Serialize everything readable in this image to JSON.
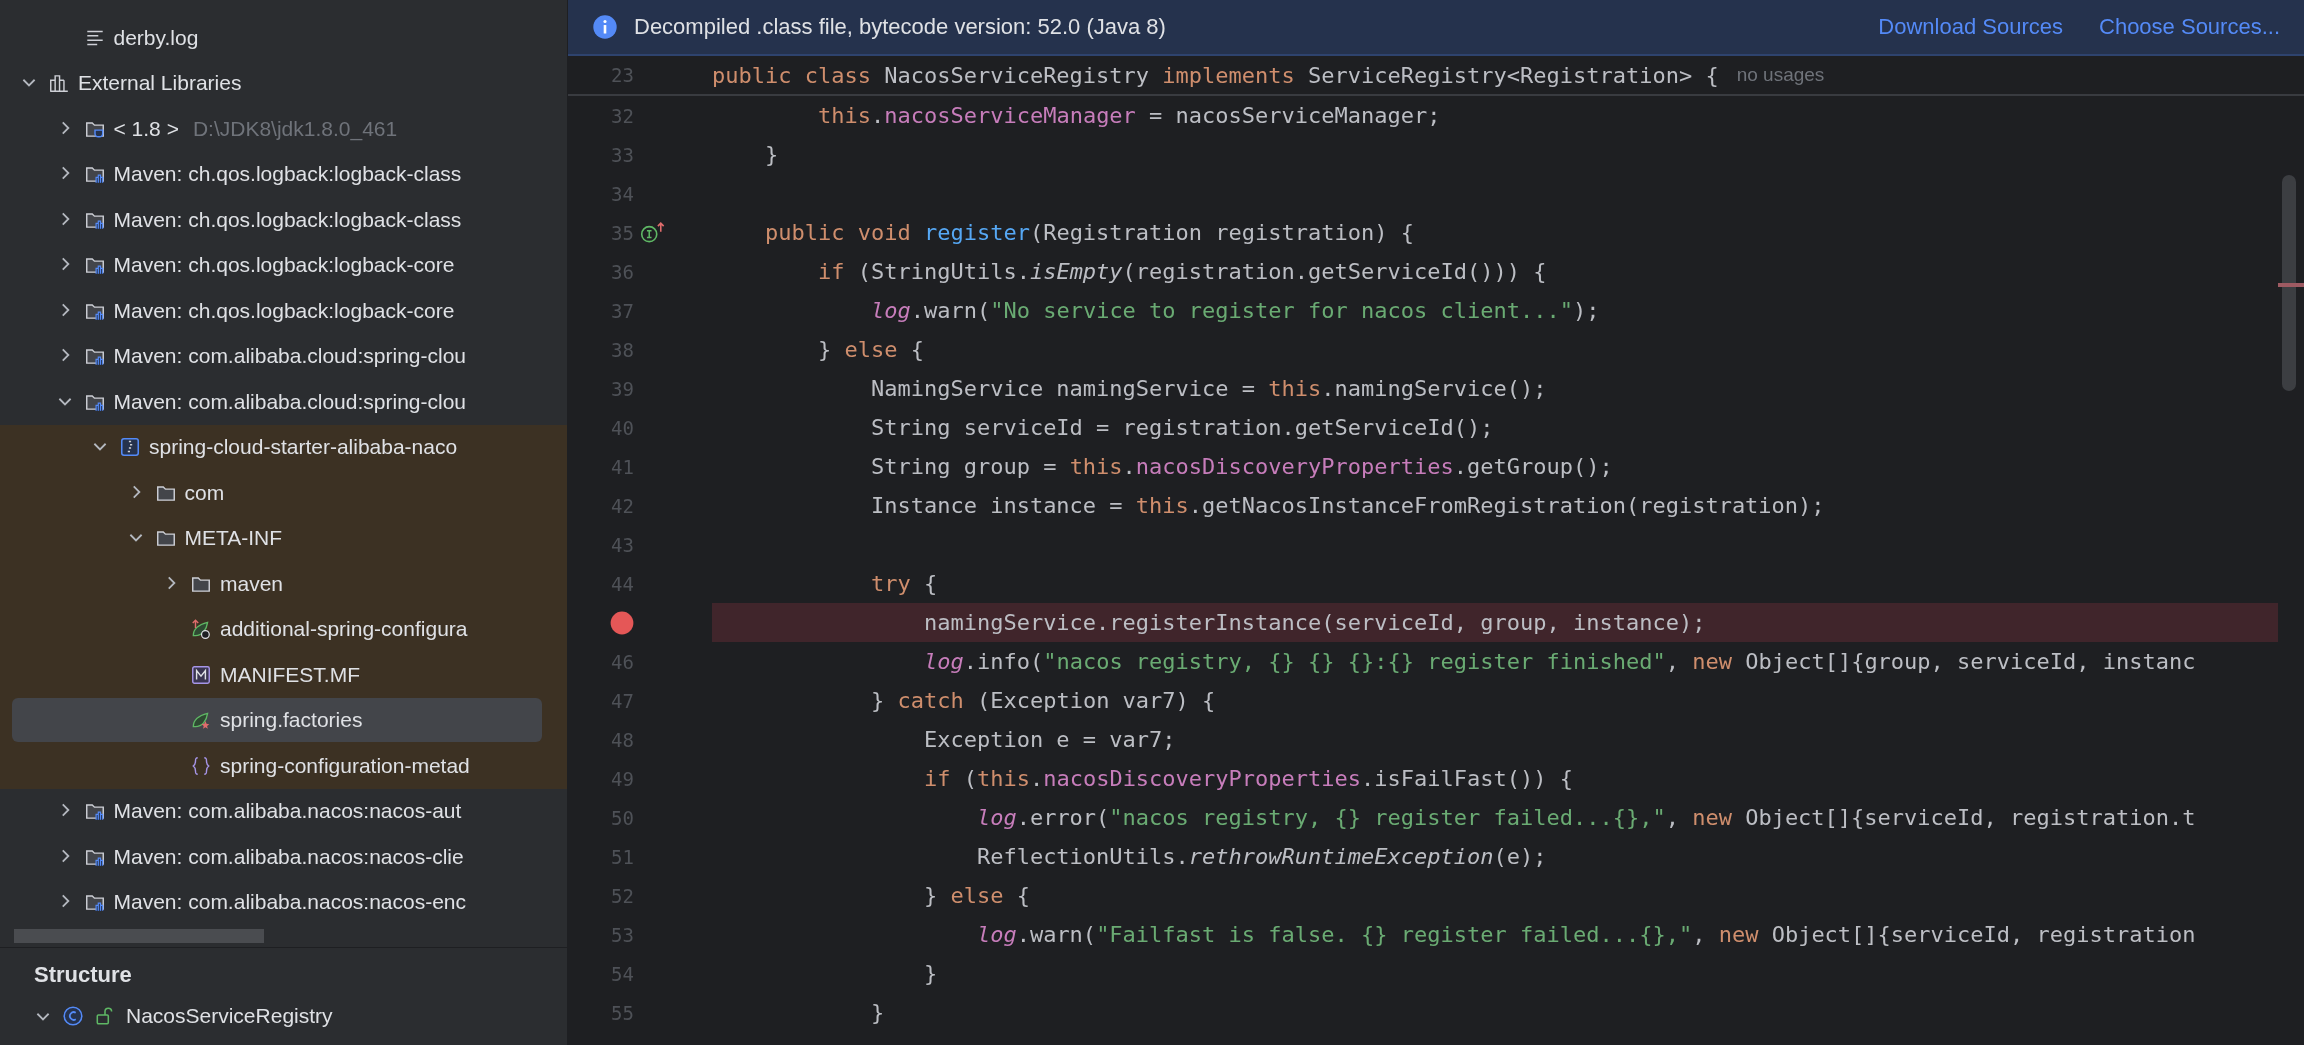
{
  "project_tree": {
    "items": [
      {
        "children": [
          {
            "label": "derby.log",
            "kind": "log-file",
            "selected": false
          }
        ]
      },
      {
        "label": "External Libraries",
        "kind": "libraries",
        "expanded": true,
        "selected": false,
        "children": [
          {
            "label": "< 1.8 >",
            "path": "D:\\JDK8\\jdk1.8.0_461",
            "kind": "jdk",
            "expanded": false,
            "selected": false
          },
          {
            "label": "Maven: ch.qos.logback:logback-class",
            "kind": "maven-library",
            "expanded": false,
            "selected": false
          },
          {
            "label": "Maven: ch.qos.logback:logback-class",
            "kind": "maven-library",
            "expanded": false,
            "selected": false
          },
          {
            "label": "Maven: ch.qos.logback:logback-core",
            "kind": "maven-library",
            "expanded": false,
            "selected": false
          },
          {
            "label": "Maven: ch.qos.logback:logback-core",
            "kind": "maven-library",
            "expanded": false,
            "selected": false
          },
          {
            "label": "Maven: com.alibaba.cloud:spring-clou",
            "kind": "maven-library",
            "expanded": false,
            "selected": false
          },
          {
            "label": "Maven: com.alibaba.cloud:spring-clou",
            "kind": "maven-library",
            "expanded": true,
            "selected": false,
            "children": [
              {
                "label": "spring-cloud-starter-alibaba-naco",
                "kind": "jar",
                "expanded": true,
                "selected": false,
                "highlighted": true,
                "children": [
                  {
                    "label": "com",
                    "kind": "folder",
                    "expanded": false,
                    "selected": false
                  },
                  {
                    "label": "META-INF",
                    "kind": "folder",
                    "expanded": true,
                    "selected": false,
                    "children": [
                      {
                        "label": "maven",
                        "kind": "folder",
                        "expanded": false,
                        "selected": false
                      },
                      {
                        "label": "additional-spring-configura",
                        "kind": "spring-config",
                        "selected": false
                      },
                      {
                        "label": "MANIFEST.MF",
                        "kind": "manifest",
                        "selected": false
                      },
                      {
                        "label": "spring.factories",
                        "kind": "spring-factories",
                        "selected": true
                      },
                      {
                        "label": "spring-configuration-metad",
                        "kind": "json-config",
                        "selected": false
                      }
                    ]
                  }
                ]
              }
            ]
          },
          {
            "label": "Maven: com.alibaba.nacos:nacos-aut",
            "kind": "maven-library",
            "expanded": false,
            "selected": false
          },
          {
            "label": "Maven: com.alibaba.nacos:nacos-clie",
            "kind": "maven-library",
            "expanded": false,
            "selected": false
          },
          {
            "label": "Maven: com.alibaba.nacos:nacos-enc",
            "kind": "maven-library",
            "expanded": false,
            "selected": false
          }
        ]
      }
    ]
  },
  "structure": {
    "title": "Structure",
    "items": [
      {
        "label": "NacosServiceRegistry",
        "kind": "class",
        "expanded": true
      }
    ]
  },
  "editor": {
    "banner": {
      "text": "Decompiled .class file, bytecode version: 52.0 (Java 8)",
      "links": [
        "Download Sources",
        "Choose Sources..."
      ]
    },
    "sticky_line": {
      "number": "23",
      "hint": "no usages",
      "tokens": [
        {
          "text": "public class ",
          "kind": "keyword"
        },
        {
          "text": "NacosServiceRegistry ",
          "kind": "plain"
        },
        {
          "text": "implements ",
          "kind": "keyword"
        },
        {
          "text": "ServiceRegistry<Registration> {",
          "kind": "plain"
        }
      ]
    },
    "lines": [
      {
        "number": "32",
        "kind": "plain",
        "breakpoint": false,
        "tokens": [
          {
            "text": "        this",
            "kind": "keyword"
          },
          {
            "text": ".",
            "kind": "plain"
          },
          {
            "text": "nacosServiceManager",
            "kind": "field"
          },
          {
            "text": " = nacosServiceManager;",
            "kind": "plain"
          }
        ]
      },
      {
        "number": "33",
        "kind": "plain",
        "breakpoint": false,
        "tokens": [
          {
            "text": "    }",
            "kind": "plain"
          }
        ]
      },
      {
        "number": "34",
        "kind": "plain",
        "breakpoint": false
      },
      {
        "number": "35",
        "kind": "implements",
        "breakpoint": false,
        "tokens": [
          {
            "text": "    public void ",
            "kind": "keyword"
          },
          {
            "text": "register",
            "kind": "method-decl"
          },
          {
            "text": "(Registration registration) {",
            "kind": "plain"
          }
        ]
      },
      {
        "number": "36",
        "kind": "plain",
        "breakpoint": false,
        "tokens": [
          {
            "text": "        if ",
            "kind": "keyword"
          },
          {
            "text": "(StringUtils.",
            "kind": "plain"
          },
          {
            "text": "isEmpty",
            "kind": "static-method"
          },
          {
            "text": "(registration.getServiceId())) {",
            "kind": "plain"
          }
        ]
      },
      {
        "number": "37",
        "kind": "plain",
        "breakpoint": false,
        "tokens": [
          {
            "text": "            log",
            "kind": "static-field"
          },
          {
            "text": ".warn(",
            "kind": "plain"
          },
          {
            "text": "\"No service to register for nacos client...\"",
            "kind": "string"
          },
          {
            "text": ");",
            "kind": "plain"
          }
        ]
      },
      {
        "number": "38",
        "kind": "plain",
        "breakpoint": false,
        "tokens": [
          {
            "text": "        } ",
            "kind": "plain"
          },
          {
            "text": "else ",
            "kind": "keyword"
          },
          {
            "text": "{",
            "kind": "plain"
          }
        ]
      },
      {
        "number": "39",
        "kind": "plain",
        "breakpoint": false,
        "tokens": [
          {
            "text": "            NamingService namingService = ",
            "kind": "plain"
          },
          {
            "text": "this",
            "kind": "keyword"
          },
          {
            "text": ".namingService();",
            "kind": "plain"
          }
        ]
      },
      {
        "number": "40",
        "kind": "plain",
        "breakpoint": false,
        "tokens": [
          {
            "text": "            String serviceId = registration.getServiceId();",
            "kind": "plain"
          }
        ]
      },
      {
        "number": "41",
        "kind": "plain",
        "breakpoint": false,
        "tokens": [
          {
            "text": "            String group = ",
            "kind": "plain"
          },
          {
            "text": "this",
            "kind": "keyword"
          },
          {
            "text": ".",
            "kind": "plain"
          },
          {
            "text": "nacosDiscoveryProperties",
            "kind": "field"
          },
          {
            "text": ".getGroup();",
            "kind": "plain"
          }
        ]
      },
      {
        "number": "42",
        "kind": "plain",
        "breakpoint": false,
        "tokens": [
          {
            "text": "            Instance instance = ",
            "kind": "plain"
          },
          {
            "text": "this",
            "kind": "keyword"
          },
          {
            "text": ".getNacosInstanceFromRegistration(registration);",
            "kind": "plain"
          }
        ]
      },
      {
        "number": "43",
        "kind": "plain",
        "breakpoint": false
      },
      {
        "number": "44",
        "kind": "plain",
        "breakpoint": false,
        "tokens": [
          {
            "text": "            try ",
            "kind": "keyword"
          },
          {
            "text": "{",
            "kind": "plain"
          }
        ]
      },
      {
        "kind": "plain",
        "breakpoint": true,
        "tokens": [
          {
            "text": "                namingService.registerInstance(serviceId, group, instance);",
            "kind": "plain"
          }
        ]
      },
      {
        "number": "46",
        "kind": "plain",
        "breakpoint": false,
        "tokens": [
          {
            "text": "                log",
            "kind": "static-field"
          },
          {
            "text": ".info(",
            "kind": "plain"
          },
          {
            "text": "\"nacos registry, {} {} {}:{} register finished\"",
            "kind": "string"
          },
          {
            "text": ", ",
            "kind": "plain"
          },
          {
            "text": "new ",
            "kind": "keyword"
          },
          {
            "text": "Object[]{group, serviceId, instanc",
            "kind": "plain"
          }
        ]
      },
      {
        "number": "47",
        "kind": "plain",
        "breakpoint": false,
        "tokens": [
          {
            "text": "            } ",
            "kind": "plain"
          },
          {
            "text": "catch ",
            "kind": "keyword"
          },
          {
            "text": "(Exception var7) {",
            "kind": "plain"
          }
        ]
      },
      {
        "number": "48",
        "kind": "plain",
        "breakpoint": false,
        "tokens": [
          {
            "text": "                Exception e = var7;",
            "kind": "plain"
          }
        ]
      },
      {
        "number": "49",
        "kind": "plain",
        "breakpoint": false,
        "tokens": [
          {
            "text": "                if ",
            "kind": "keyword"
          },
          {
            "text": "(",
            "kind": "plain"
          },
          {
            "text": "this",
            "kind": "keyword"
          },
          {
            "text": ".",
            "kind": "plain"
          },
          {
            "text": "nacosDiscoveryProperties",
            "kind": "field"
          },
          {
            "text": ".isFailFast()) {",
            "kind": "plain"
          }
        ]
      },
      {
        "number": "50",
        "kind": "plain",
        "breakpoint": false,
        "tokens": [
          {
            "text": "                    log",
            "kind": "static-field"
          },
          {
            "text": ".error(",
            "kind": "plain"
          },
          {
            "text": "\"nacos registry, {} register failed...{},\"",
            "kind": "string"
          },
          {
            "text": ", ",
            "kind": "plain"
          },
          {
            "text": "new ",
            "kind": "keyword"
          },
          {
            "text": "Object[]{serviceId, registration.t",
            "kind": "plain"
          }
        ]
      },
      {
        "number": "51",
        "kind": "plain",
        "breakpoint": false,
        "tokens": [
          {
            "text": "                    ReflectionUtils.",
            "kind": "plain"
          },
          {
            "text": "rethrowRuntimeException",
            "kind": "static-method"
          },
          {
            "text": "(e);",
            "kind": "plain"
          }
        ]
      },
      {
        "number": "52",
        "kind": "plain",
        "breakpoint": false,
        "tokens": [
          {
            "text": "                } ",
            "kind": "plain"
          },
          {
            "text": "else ",
            "kind": "keyword"
          },
          {
            "text": "{",
            "kind": "plain"
          }
        ]
      },
      {
        "number": "53",
        "kind": "plain",
        "breakpoint": false,
        "tokens": [
          {
            "text": "                    log",
            "kind": "static-field"
          },
          {
            "text": ".warn(",
            "kind": "plain"
          },
          {
            "text": "\"Failfast is false. {} register failed...{},\"",
            "kind": "string"
          },
          {
            "text": ", ",
            "kind": "plain"
          },
          {
            "text": "new ",
            "kind": "keyword"
          },
          {
            "text": "Object[]{serviceId, registration",
            "kind": "plain"
          }
        ]
      },
      {
        "number": "54",
        "kind": "plain",
        "breakpoint": false,
        "tokens": [
          {
            "text": "                }",
            "kind": "plain"
          }
        ]
      },
      {
        "number": "55",
        "kind": "plain",
        "breakpoint": false,
        "tokens": [
          {
            "text": "            }",
            "kind": "plain"
          }
        ]
      }
    ]
  }
}
